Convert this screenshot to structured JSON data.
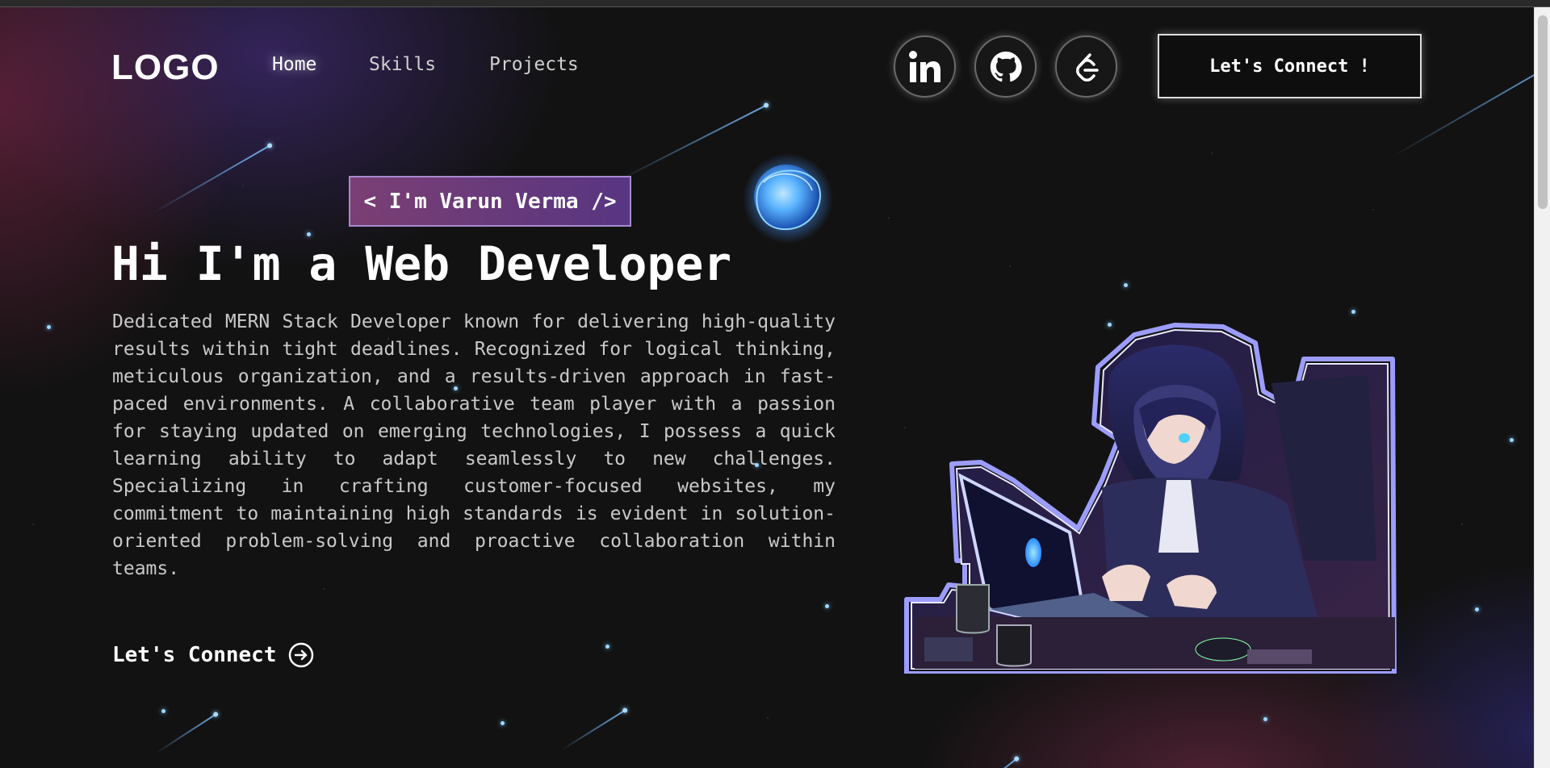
{
  "nav": {
    "logo": "LOGO",
    "links": [
      {
        "label": "Home",
        "active": true
      },
      {
        "label": "Skills",
        "active": false
      },
      {
        "label": "Projects",
        "active": false
      }
    ],
    "social_icons": [
      "linkedin-icon",
      "github-icon",
      "leetcode-icon"
    ],
    "connect_label": "Let's Connect !"
  },
  "hero": {
    "tagline": "< I'm Varun Verma />",
    "headline": "Hi I'm a Web Developer",
    "bio": "Dedicated MERN Stack Developer known for delivering high-quality results within tight deadlines. Recognized for logical thinking, meticulous organization, and a results-driven approach in fast-paced environments. A collaborative team player with a passion for staying updated on emerging technologies, I possess a quick learning ability to adapt seamlessly to new challenges. Specializing in crafting customer-focused websites, my commitment to maintaining high standards is evident in solution-oriented problem-solving and proactive collaboration within teams.",
    "cta_label": "Let's Connect",
    "cta_icon": "arrow-right-circle-icon",
    "illustration": "hooded-developer-with-laptop"
  },
  "colors": {
    "background": "#121212",
    "tagline_gradient_start": "#8c4682",
    "tagline_gradient_end": "#643c96",
    "accent_blue": "#4aa8ff",
    "art_outline": "#8f8cff"
  }
}
